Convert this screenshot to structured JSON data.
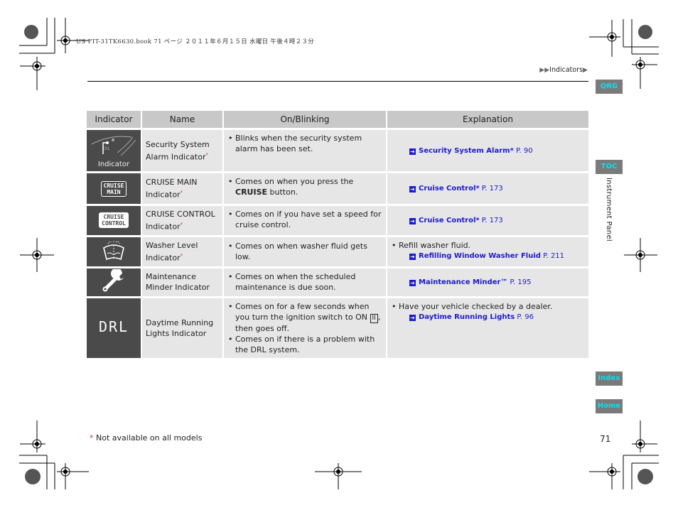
{
  "print_header": "US FIT-31TK6630.book  71 ページ  ２０１１年６月１５日  水曜日  午後４時２３分",
  "breadcrumb": {
    "prefix": "▶▶",
    "label": "Indicators",
    "suffix": "▶"
  },
  "side_nav": {
    "qrg": "QRG",
    "toc": "TOC",
    "section": "Instrument Panel",
    "index": "Index",
    "home": "Home"
  },
  "table": {
    "headers": [
      "Indicator",
      "Name",
      "On/Blinking",
      "Explanation"
    ],
    "rows": [
      {
        "icon": "security-alarm-icon",
        "icon_caption": "Indicator",
        "name": "Security System Alarm Indicator",
        "req": "*",
        "on": [
          "Blinks when the security system alarm has been set."
        ],
        "expl_text": "",
        "ref_title": "Security System Alarm",
        "ref_req": "*",
        "ref_page": "P. 90"
      },
      {
        "icon": "cruise-main-icon",
        "icon_text": [
          "CRUISE",
          "MAIN"
        ],
        "name": "CRUISE MAIN Indicator",
        "req": "*",
        "on_pre": "Comes on when you press the ",
        "on_bold": "CRUISE",
        "on_post": " button.",
        "ref_title": "Cruise Control",
        "ref_req": "*",
        "ref_page": "P. 173"
      },
      {
        "icon": "cruise-control-icon",
        "icon_text": [
          "CRUISE",
          "CONTROL"
        ],
        "name": "CRUISE CONTROL Indicator",
        "req": "*",
        "on": [
          "Comes on if you have set a speed for cruise control."
        ],
        "ref_title": "Cruise Control",
        "ref_req": "*",
        "ref_page": "P. 173"
      },
      {
        "icon": "washer-level-icon",
        "name": "Washer Level Indicator",
        "req": "*",
        "on": [
          "Comes on when washer fluid gets low."
        ],
        "expl_text": "Refill washer fluid.",
        "ref_title": "Refilling Window Washer Fluid",
        "ref_page": "P. 211"
      },
      {
        "icon": "wrench-icon",
        "name": "Maintenance Minder Indicator",
        "on": [
          "Comes on when the scheduled maintenance is due soon."
        ],
        "ref_title": "Maintenance Minder™",
        "ref_page": "P. 195"
      },
      {
        "icon": "drl-icon",
        "icon_text": "DRL",
        "name": "Daytime Running Lights Indicator",
        "on1_pre": "Comes on for a few seconds when you turn the ignition switch to ON ",
        "on1_key": "II",
        "on1_post": ", then goes off.",
        "on2": "Comes on if there is a problem with the DRL system.",
        "expl_text": "Have your vehicle checked by a dealer.",
        "ref_title": "Daytime Running Lights",
        "ref_page": "P. 96"
      }
    ]
  },
  "footnote": {
    "star": "*",
    "text": "Not available on all models"
  },
  "page_number": "71"
}
